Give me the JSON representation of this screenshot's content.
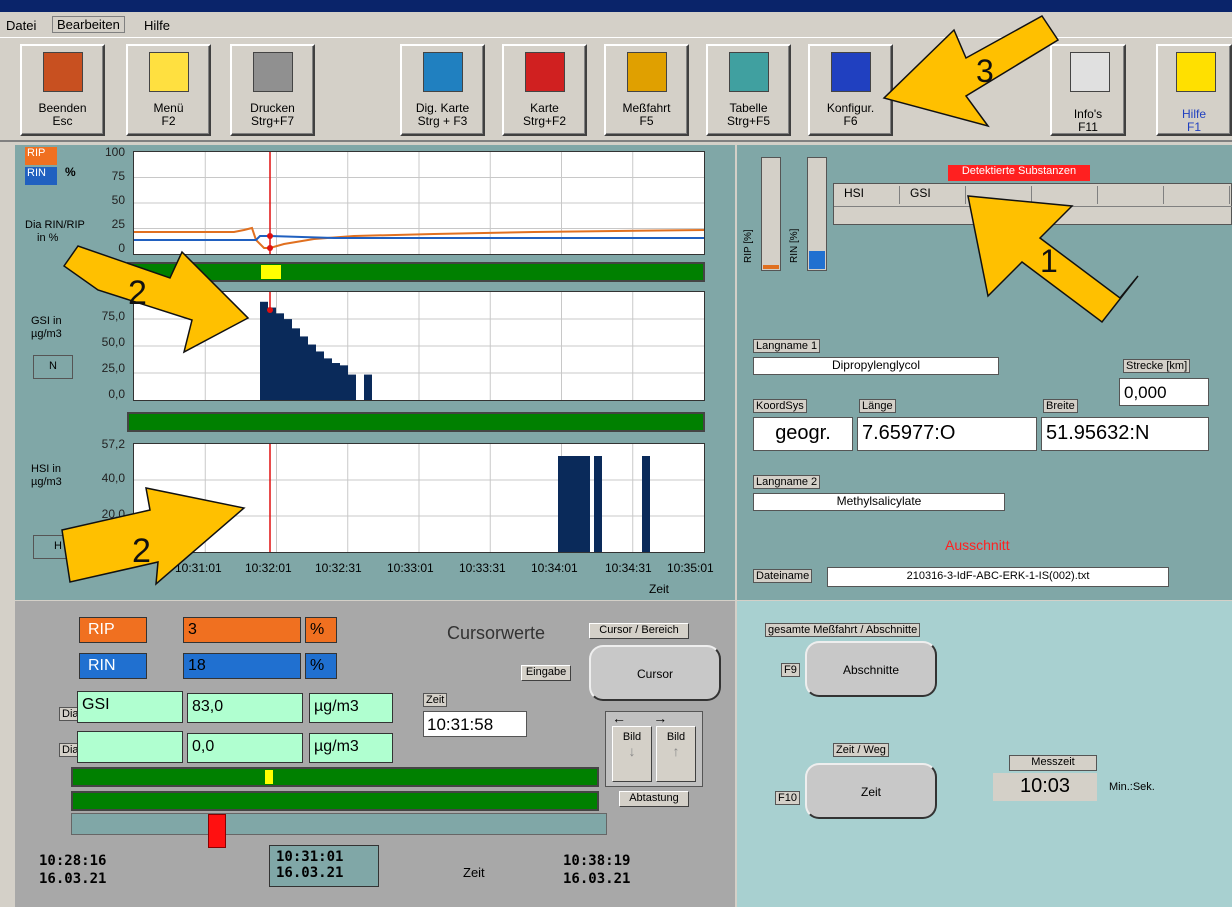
{
  "menu": {
    "items": [
      "Datei",
      "Bearbeiten",
      "Hilfe"
    ]
  },
  "toolbar": {
    "buttons": [
      {
        "line1": "Beenden",
        "line2": "Esc",
        "icon": "door-exit-icon",
        "color": "#c85020"
      },
      {
        "line1": "Menü",
        "line2": "F2",
        "icon": "menu-list-icon",
        "color": "#ffe040"
      },
      {
        "line1": "Drucken",
        "line2": "Strg+F7",
        "icon": "printer-icon",
        "color": "#909090"
      },
      {
        "line1": "Dig. Karte",
        "line2": "Strg + F3",
        "icon": "globe-icon",
        "color": "#2080c0"
      },
      {
        "line1": "Karte",
        "line2": "Strg+F2",
        "icon": "germany-map-icon",
        "color": "#d02020"
      },
      {
        "line1": "Meßfahrt",
        "line2": "F5",
        "icon": "measurement-run-icon",
        "color": "#e0a000"
      },
      {
        "line1": "Tabelle",
        "line2": "Strg+F5",
        "icon": "table-icon",
        "color": "#40a0a0"
      },
      {
        "line1": "Konfigur.",
        "line2": "F6",
        "icon": "config-arrows-icon",
        "color": "#2040c0"
      },
      {
        "line1": "Info's",
        "line2": "F11",
        "icon": "info-notebook-icon",
        "color": "#e0e0e0"
      },
      {
        "line1": "Hilfe",
        "line2": "F1",
        "icon": "help-question-icon",
        "color": "#ffe000"
      }
    ]
  },
  "chart1": {
    "legend_rip": "RIP",
    "legend_rin": "RIN",
    "unit": "%",
    "title_line1": "Dia RIN/RIP",
    "title_line2": "in %",
    "yticks": [
      "100",
      "75",
      "50",
      "25",
      "0"
    ]
  },
  "chart2": {
    "title_line1": "GSI   in",
    "title_line2": "µg/m3",
    "mode": "N",
    "yticks": [
      "75,0",
      "50,0",
      "25,0",
      "0,0"
    ]
  },
  "chart3": {
    "title_line1": "HSI   in",
    "title_line2": "µg/m3",
    "mode": "H",
    "yticks": [
      "57,2",
      "40,0",
      "20,0"
    ]
  },
  "xaxis": {
    "ticks": [
      "10:31:01",
      "10:32:01",
      "10:32:31",
      "10:33:01",
      "10:33:31",
      "10:34:01",
      "10:34:31",
      "10:35:01"
    ],
    "label": "Zeit"
  },
  "chart_data": [
    {
      "type": "line",
      "series": [
        {
          "name": "RIP",
          "color": "#e07020"
        },
        {
          "name": "RIN",
          "color": "#2060c0"
        }
      ],
      "ylabel": "Dia RIN/RIP in %",
      "ylim": [
        0,
        100
      ]
    },
    {
      "type": "bar",
      "series": [
        {
          "name": "GSI",
          "color": "#0a2a5a",
          "values": [
            0,
            85,
            80,
            75,
            70,
            62,
            55,
            48,
            42,
            36,
            32,
            30,
            22,
            0,
            22,
            0
          ]
        }
      ],
      "ylim": [
        0,
        90
      ]
    },
    {
      "type": "bar",
      "series": [
        {
          "name": "HSI",
          "color": "#0a2a5a"
        }
      ],
      "ylim": [
        0,
        57.2
      ]
    }
  ],
  "right": {
    "detected_header": "Detektierte Substanzen",
    "table_cols": [
      "HSI",
      "GSI",
      "",
      "",
      "",
      "",
      ""
    ],
    "gauge_rip": "RIP [%]",
    "gauge_rin": "RIN [%]",
    "langname1_label": "Langname 1",
    "langname1": "Dipropylenglycol",
    "strecke_label": "Strecke [km]",
    "strecke": "0,000",
    "koord_label": "KoordSys",
    "koord": "geogr.",
    "laenge_label": "Länge",
    "laenge": "7.65977:O",
    "breite_label": "Breite",
    "breite": "51.95632:N",
    "langname2_label": "Langname 2",
    "langname2": "Methylsalicylate",
    "ausschnitt": "Ausschnitt",
    "dateiname_label": "Dateiname",
    "dateiname": "210316-3-IdF-ABC-ERK-1-IS(002).txt"
  },
  "cursor": {
    "rip_label": "RIP",
    "rip_value": "3",
    "rip_unit": "%",
    "rin_label": "RIN",
    "rin_value": "18",
    "rin_unit": "%",
    "title": "Cursorwerte",
    "dia2": "Dia 2",
    "dia2_sub": "GSI",
    "dia2_val": "83,0",
    "dia2_unit": "µg/m3",
    "dia3": "Dia 3",
    "dia3_sub": "",
    "dia3_val": "0,0",
    "dia3_unit": "µg/m3",
    "zeit_label": "Zeit",
    "zeit": "10:31:58",
    "cursor_bereich": "Cursor / Bereich",
    "eingabe": "Eingabe",
    "cursor_btn": "Cursor",
    "bild1": "Bild",
    "bild2": "Bild",
    "abtastung": "Abtastung",
    "t_start": "10:28:16",
    "d_start": "16.03.21",
    "t_mid": "10:31:01",
    "d_mid": "16.03.21",
    "zeit_mid": "Zeit",
    "t_end": "10:38:19",
    "d_end": "16.03.21"
  },
  "sections": {
    "gesamte": "gesamte Meßfahrt / Abschnitte",
    "f9": "F9",
    "abschnitte": "Abschnitte",
    "zeitweg": "Zeit / Weg",
    "f10": "F10",
    "zeit_btn": "Zeit",
    "messzeit_label": "Messzeit",
    "messzeit": "10:03",
    "minsek": "Min.:Sek."
  },
  "arrows": {
    "a1": "1",
    "a2": "2",
    "a2b": "2",
    "a3": "3"
  }
}
